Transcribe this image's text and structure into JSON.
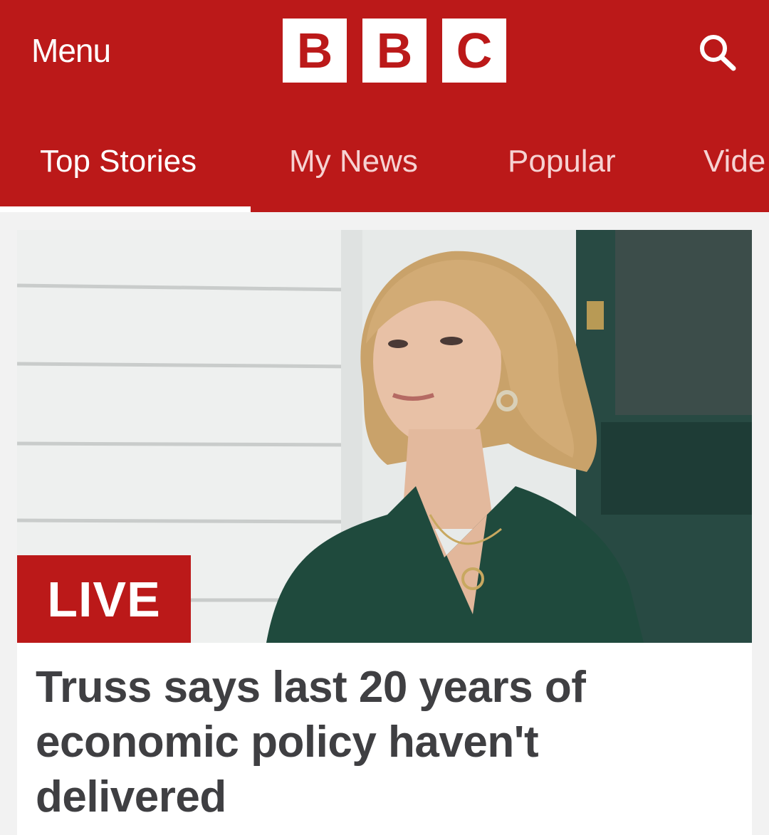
{
  "header": {
    "menu_label": "Menu",
    "logo_letters": [
      "B",
      "B",
      "C"
    ],
    "search_icon": "search-icon",
    "brand_color": "#bb1919"
  },
  "tabs": [
    {
      "label": "Top Stories",
      "active": true
    },
    {
      "label": "My News",
      "active": false
    },
    {
      "label": "Popular",
      "active": false
    },
    {
      "label": "Vide",
      "active": false
    }
  ],
  "story": {
    "badge": "LIVE",
    "headline": "Truss says last 20 years of economic policy haven't delivered"
  }
}
